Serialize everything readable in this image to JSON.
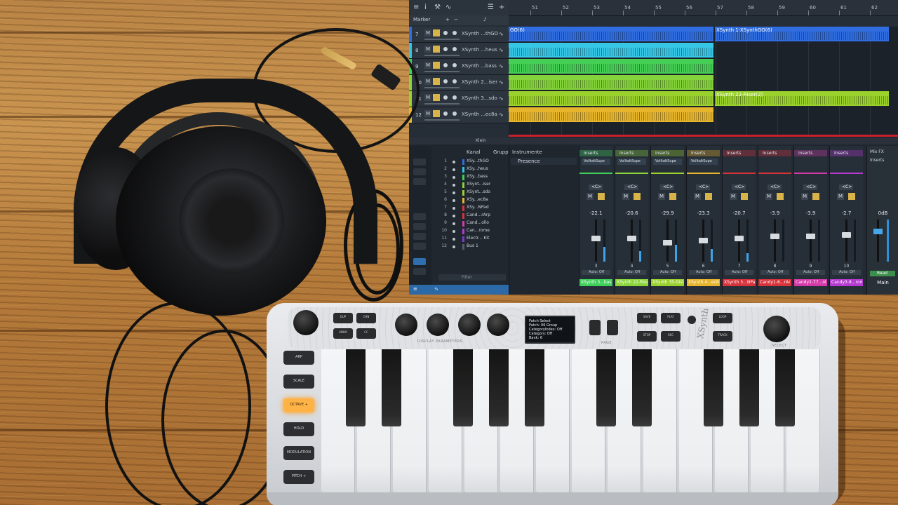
{
  "daw": {
    "toolbar": {
      "marker_label": "Marker"
    },
    "ruler": {
      "bars": [
        "51",
        "52",
        "53",
        "54",
        "55",
        "56",
        "57",
        "58",
        "59",
        "60",
        "61",
        "62"
      ]
    },
    "tracks": [
      {
        "num": "7",
        "name": "XSynth ...thGO",
        "color": "#2f6de0"
      },
      {
        "num": "8",
        "name": "XSynth ...heus",
        "color": "#2fc4e8"
      },
      {
        "num": "9",
        "name": "XSynth ...bass",
        "color": "#3fcf5a"
      },
      {
        "num": "10",
        "name": "XSynth 2...iser",
        "color": "#8bd43a"
      },
      {
        "num": "11",
        "name": "XSynth 3...sdo",
        "color": "#9ad12d"
      },
      {
        "num": "12",
        "name": "XSynth ...ec8a",
        "color": "#e6b52c"
      }
    ],
    "clips": [
      {
        "label": "GO(6)",
        "color": "#2f6de0"
      },
      {
        "label": "XSynth 1-XSynthGO(6)",
        "color": "#2f6de0"
      },
      {
        "label": "",
        "color": "#37c7e6"
      },
      {
        "label": "",
        "color": "#45cf55"
      },
      {
        "label": "",
        "color": "#84d33a"
      },
      {
        "label": "",
        "color": "#9ad12d"
      },
      {
        "label": "XSynth 22-Riser(2)",
        "color": "#9ad12d"
      },
      {
        "label": "",
        "color": "#e6b52c"
      }
    ],
    "bottom_bar": {
      "zoom_label": "Klein"
    },
    "mixer": {
      "list_headers": {
        "kanal": "Kanal",
        "gruppe": "Gruppe"
      },
      "channels": [
        {
          "n": "1",
          "name": "XSy...thGO",
          "color": "#2f6de0"
        },
        {
          "n": "2",
          "name": "XSy...heus",
          "color": "#2fc4e8"
        },
        {
          "n": "3",
          "name": "XSy...bass",
          "color": "#3fcf5a"
        },
        {
          "n": "4",
          "name": "XSynt...iser",
          "color": "#8bd43a"
        },
        {
          "n": "5",
          "name": "XSynt...sdo",
          "color": "#9ad12d"
        },
        {
          "n": "6",
          "name": "XSy...ec8a",
          "color": "#e6b52c"
        },
        {
          "n": "7",
          "name": "XSy...NPad",
          "color": "#d8323b"
        },
        {
          "n": "8",
          "name": "Cand...rArp",
          "color": "#d8323b"
        },
        {
          "n": "9",
          "name": "Cand...ollo",
          "color": "#d33aa8"
        },
        {
          "n": "10",
          "name": "Can...rome",
          "color": "#b43ad1"
        },
        {
          "n": "11",
          "name": "Electr... Kit",
          "color": "#7a3ad1"
        },
        {
          "n": "12",
          "name": "Bus 1",
          "color": "#555c66"
        }
      ],
      "filter_placeholder": "Filter",
      "instruments": {
        "header": "Instrumente",
        "selected": "Presence"
      },
      "strips": [
        {
          "plugin": "VolltaltSupe",
          "value": "-22.1",
          "num": "3",
          "label": "XSynth 3...bas",
          "color": "#3fcf5a",
          "fader": 0.55,
          "meter": 0.35
        },
        {
          "plugin": "VolltaltSupe",
          "value": "-20.6",
          "num": "4",
          "label": "XSynth 22-Rise",
          "color": "#8bd43a",
          "fader": 0.55,
          "meter": 0.25
        },
        {
          "plugin": "VolltaltSupe",
          "value": "-29.9",
          "num": "5",
          "label": "XSynth 35-Disto",
          "color": "#9ad12d",
          "fader": 0.45,
          "meter": 0.4
        },
        {
          "plugin": "VolltaltSupe",
          "value": "-23.3",
          "num": "6",
          "label": "XSynth 4...ec8a",
          "color": "#e6b52c",
          "fader": 0.5,
          "meter": 0.3
        },
        {
          "plugin": "",
          "value": "-20.7",
          "num": "7",
          "label": "XSynth 5...NPad",
          "color": "#d8323b",
          "fader": 0.55,
          "meter": 0.2
        },
        {
          "plugin": "",
          "value": "-3.9",
          "num": "8",
          "label": "Candy1-6...rArp",
          "color": "#d8323b",
          "fader": 0.62,
          "meter": 0.0
        },
        {
          "plugin": "",
          "value": "-3.9",
          "num": "9",
          "label": "Candy2-77...ollo",
          "color": "#d33aa8",
          "fader": 0.62,
          "meter": 0.0
        },
        {
          "plugin": "",
          "value": "-2.7",
          "num": "10",
          "label": "Candy3-8...rome",
          "color": "#b43ad1",
          "fader": 0.65,
          "meter": 0.0
        }
      ],
      "strip_inserts_label": "Inserts",
      "strip_auto_label": "Auto: Off",
      "main": {
        "header": "Mix FX",
        "inserts": "Inserts",
        "db": "0dB",
        "auto": "Read",
        "name": "Main"
      }
    }
  },
  "keyboard": {
    "brand": "XSynth",
    "buttons_top": [
      "DUP",
      "CHN",
      "UNDO",
      "CC",
      "SAVE",
      "PLAY",
      "STOP",
      "REC",
      "LOOP",
      "TRACK"
    ],
    "side_buttons": [
      "ARP",
      "SCALE",
      "OCTAVE +",
      "HOLD",
      "MODULATION",
      "PITCH +"
    ],
    "lit_index": 2,
    "display_label": "DISPLAY PARAMETERS",
    "page_label": "PAGE",
    "select_label": "SELECT",
    "oled_lines": [
      "Patch Select",
      "Patch: 06 Group",
      "CategoryIndex: Off",
      "Category: Off",
      "Bank: 6"
    ]
  }
}
